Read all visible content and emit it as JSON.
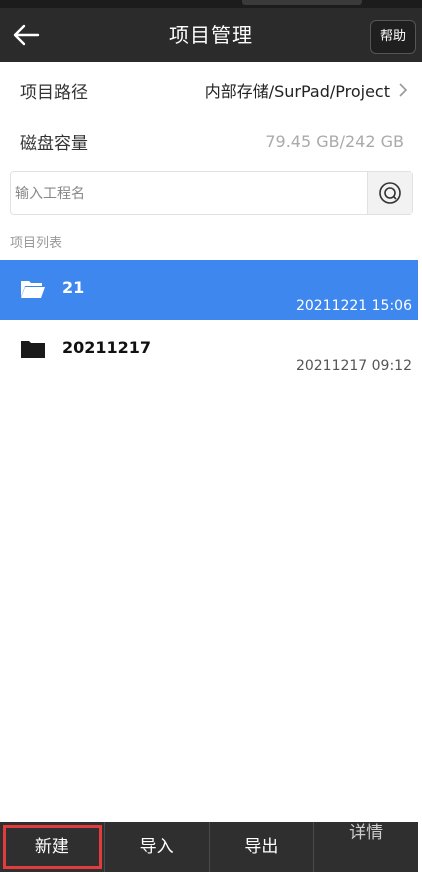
{
  "header": {
    "title": "项目管理",
    "help_label": "帮助"
  },
  "info": {
    "path_label": "项目路径",
    "path_value": "内部存储/SurPad/Project",
    "disk_label": "磁盘容量",
    "disk_value": "79.45 GB/242 GB"
  },
  "search": {
    "placeholder": "输入工程名",
    "value": ""
  },
  "list": {
    "section_label": "项目列表",
    "items": [
      {
        "name": "21",
        "time": "20211221 15:06",
        "selected": true
      },
      {
        "name": "20211217",
        "time": "20211217 09:12",
        "selected": false
      }
    ]
  },
  "bottombar": {
    "tabs": [
      "新建",
      "导入",
      "导出",
      "详情"
    ]
  },
  "colors": {
    "header_bg": "#2b2b2b",
    "selected_bg": "#3d87ef",
    "bottom_bg": "#2f2f2f",
    "highlight_outline": "#e23b3b"
  }
}
